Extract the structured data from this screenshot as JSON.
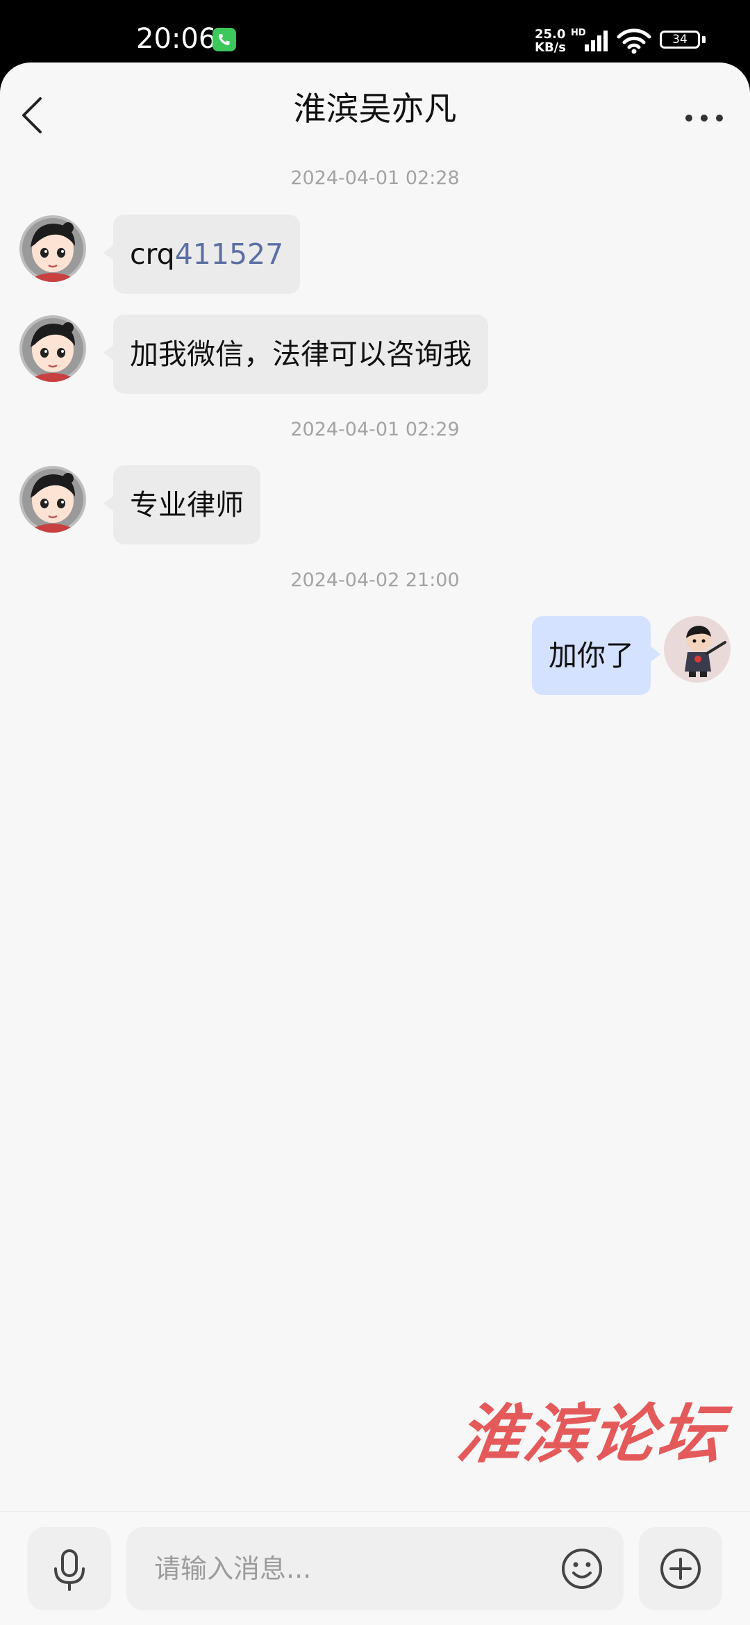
{
  "status_bar": {
    "time": "20:06",
    "net_speed_value": "25.0",
    "net_speed_unit": "KB/s",
    "hd_label": "HD",
    "battery": "34"
  },
  "header": {
    "title": "淮滨吴亦凡"
  },
  "messages": [
    {
      "type": "timestamp",
      "text": "2024-04-01 02:28"
    },
    {
      "type": "incoming",
      "text_prefix": "crq",
      "text_link": "411527"
    },
    {
      "type": "incoming",
      "text": "加我微信，法律可以咨询我"
    },
    {
      "type": "timestamp",
      "text": "2024-04-01 02:29"
    },
    {
      "type": "incoming",
      "text": "专业律师"
    },
    {
      "type": "timestamp",
      "text": "2024-04-02 21:00"
    },
    {
      "type": "outgoing",
      "text": "加你了"
    }
  ],
  "watermark": "淮滨论坛",
  "input_bar": {
    "placeholder": "请输入消息..."
  },
  "colors": {
    "incoming_bubble": "#ebebeb",
    "outgoing_bubble": "#d4e1ff",
    "link": "#5b6fa3",
    "watermark": "#e45a5a"
  }
}
